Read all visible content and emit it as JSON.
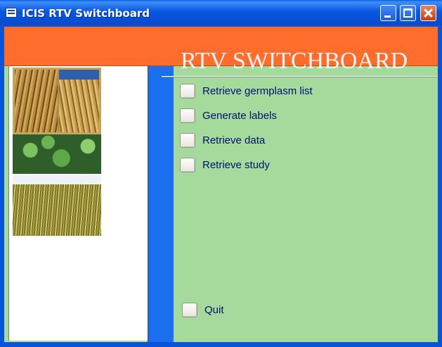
{
  "window": {
    "title": "ICIS RTV Switchboard",
    "icon": "form-icon",
    "controls": [
      "minimize-icon",
      "maximize-icon",
      "close-icon"
    ]
  },
  "header": {
    "title": "RTV SWITCHBOARD",
    "band_color": "#ff6d2c"
  },
  "colors": {
    "background": "#a6da9d",
    "accent_bar": "#1a6ff0",
    "label_text": "#00106e"
  },
  "menu": {
    "items": [
      {
        "label": "Retrieve germplasm list"
      },
      {
        "label": "Generate labels"
      },
      {
        "label": "Retrieve data"
      },
      {
        "label": "Retrieve study"
      }
    ],
    "quit_label": "Quit"
  }
}
